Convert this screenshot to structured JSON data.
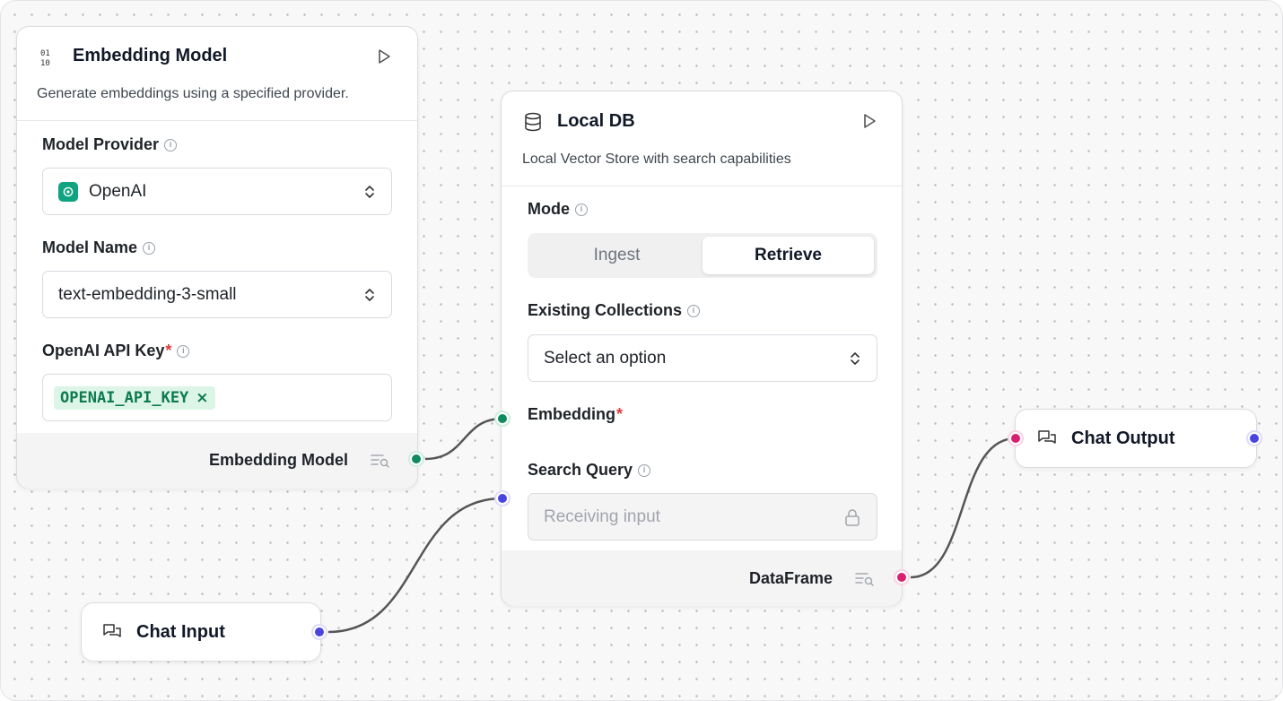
{
  "embedding_node": {
    "title": "Embedding Model",
    "description": "Generate embeddings using a specified provider.",
    "provider_label": "Model Provider",
    "provider_value": "OpenAI",
    "model_name_label": "Model Name",
    "model_name_value": "text-embedding-3-small",
    "api_key_label": "OpenAI API Key",
    "api_key_required": "*",
    "api_key_chip": "OPENAI_API_KEY",
    "api_key_chip_remove": "×",
    "output_label": "Embedding Model"
  },
  "localdb_node": {
    "title": "Local DB",
    "description": "Local Vector Store with search capabilities",
    "mode_label": "Mode",
    "mode_options": [
      "Ingest",
      "Retrieve"
    ],
    "mode_selected": "Retrieve",
    "collections_label": "Existing Collections",
    "collections_placeholder": "Select an option",
    "embedding_label": "Embedding",
    "embedding_required": "*",
    "search_query_label": "Search Query",
    "search_query_placeholder": "Receiving input",
    "output_label": "DataFrame"
  },
  "chat_input_node": {
    "title": "Chat Input"
  },
  "chat_output_node": {
    "title": "Chat Output"
  },
  "colors": {
    "embedding_handle": "#0d8a5f",
    "message_handle": "#4b45e0",
    "dataframe_handle": "#d9206f",
    "openai_brand": "#10a37f",
    "required_star": "#e23b3b"
  },
  "icons": {
    "embedding_node": "binary-icon",
    "localdb_node": "database-icon",
    "chat_nodes": "chat-bubbles-icon",
    "run": "play-icon",
    "select": "chevron-up-down-icon",
    "lock": "lock-icon",
    "output_inspect": "list-search-icon",
    "info": "info-icon"
  }
}
